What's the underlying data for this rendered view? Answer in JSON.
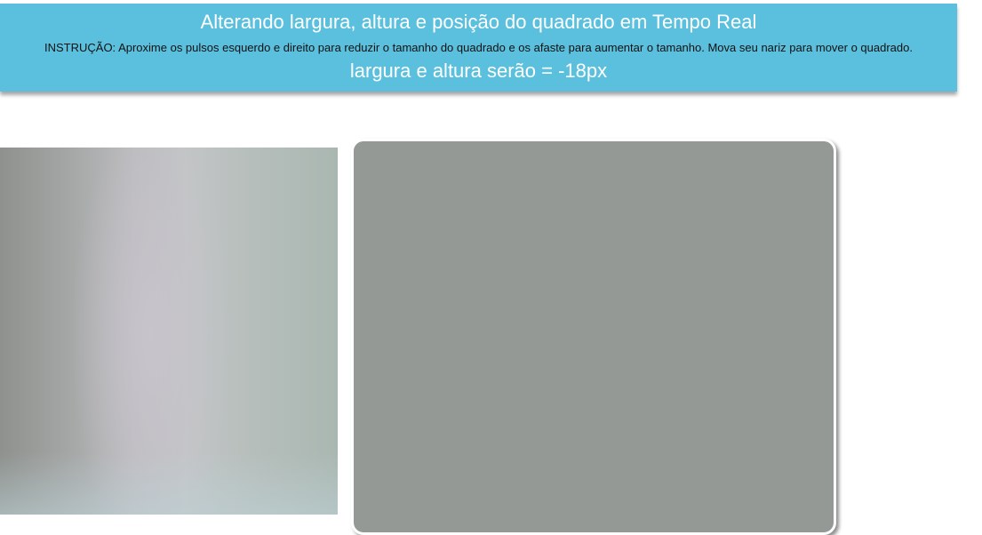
{
  "header": {
    "title": "Alterando largura, altura e posição do quadrado em Tempo Real",
    "instruction": "INSTRUÇÃO: Aproxime os pulsos esquerdo e direito para reduzir o tamanho do quadrado e os afaste para aumentar o tamanho. Mova seu nariz para mover o quadrado.",
    "status": "largura e altura serão = -18px"
  },
  "colors": {
    "header_background": "#5bc0de",
    "canvas_background": "#959995"
  }
}
